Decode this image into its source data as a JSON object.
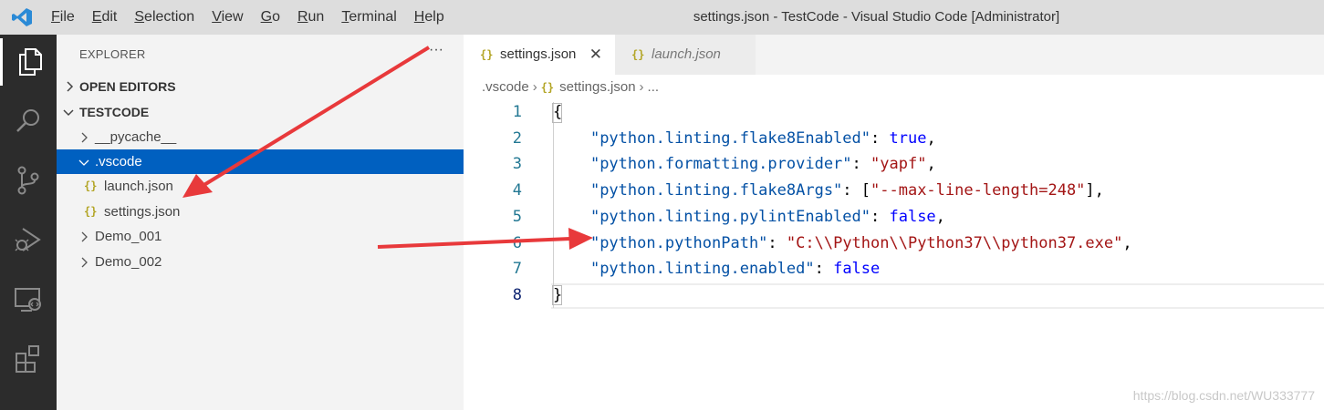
{
  "window": {
    "title": "settings.json - TestCode - Visual Studio Code [Administrator]"
  },
  "menu": [
    {
      "label": "File",
      "u": "F",
      "rest": "ile"
    },
    {
      "label": "Edit",
      "u": "E",
      "rest": "dit"
    },
    {
      "label": "Selection",
      "u": "S",
      "rest": "election"
    },
    {
      "label": "View",
      "u": "V",
      "rest": "iew"
    },
    {
      "label": "Go",
      "u": "G",
      "rest": "o"
    },
    {
      "label": "Run",
      "u": "R",
      "rest": "un"
    },
    {
      "label": "Terminal",
      "u": "T",
      "rest": "erminal"
    },
    {
      "label": "Help",
      "u": "H",
      "rest": "elp"
    }
  ],
  "sidebar": {
    "title": "EXPLORER",
    "more": "···",
    "open_editors": "OPEN EDITORS",
    "workspace": "TESTCODE",
    "tree": {
      "pycache": "__pycache__",
      "vscode": ".vscode",
      "launch": "launch.json",
      "settings": "settings.json",
      "demo1": "Demo_001",
      "demo2": "Demo_002"
    }
  },
  "json_icon": "{}",
  "tabs": [
    {
      "label": "settings.json",
      "active": true
    },
    {
      "label": "launch.json",
      "active": false
    }
  ],
  "breadcrumb": {
    "folder": ".vscode",
    "file": "settings.json",
    "more": "..."
  },
  "editor": {
    "line_numbers": [
      "1",
      "2",
      "3",
      "4",
      "5",
      "6",
      "7",
      "8"
    ],
    "current_line": 8,
    "lines": {
      "l1": "{",
      "l2_key": "\"python.linting.flake8Enabled\"",
      "l2_val": "true",
      "l3_key": "\"python.formatting.provider\"",
      "l3_val": "\"yapf\"",
      "l4_key": "\"python.linting.flake8Args\"",
      "l4_val": "\"--max-line-length=248\"",
      "l5_key": "\"python.linting.pylintEnabled\"",
      "l5_val": "false",
      "l6_key": "\"python.pythonPath\"",
      "l6_val": "\"C:\\\\Python\\\\Python37\\\\python37.exe\"",
      "l7_key": "\"python.linting.enabled\"",
      "l7_val": "false",
      "l8": "}"
    }
  },
  "watermark": "https://blog.csdn.net/WU333777",
  "colors": {
    "accent_arrow": "#e8393b",
    "selection": "#0060c0",
    "activity_bar": "#2c2c2c"
  },
  "icons": [
    "vscode-logo-icon",
    "explorer-icon",
    "search-icon",
    "source-control-icon",
    "run-debug-icon",
    "remote-explorer-icon",
    "extensions-icon",
    "chevron-right-icon",
    "chevron-down-icon",
    "json-file-icon",
    "close-icon",
    "annotation-arrow"
  ]
}
